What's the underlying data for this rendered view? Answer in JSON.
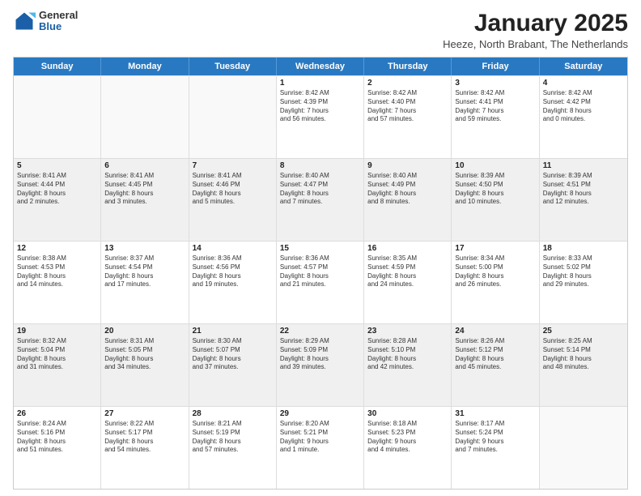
{
  "logo": {
    "general": "General",
    "blue": "Blue"
  },
  "header": {
    "title": "January 2025",
    "subtitle": "Heeze, North Brabant, The Netherlands"
  },
  "calendar": {
    "days": [
      "Sunday",
      "Monday",
      "Tuesday",
      "Wednesday",
      "Thursday",
      "Friday",
      "Saturday"
    ],
    "weeks": [
      [
        {
          "day": "",
          "content": ""
        },
        {
          "day": "",
          "content": ""
        },
        {
          "day": "",
          "content": ""
        },
        {
          "day": "1",
          "content": "Sunrise: 8:42 AM\nSunset: 4:39 PM\nDaylight: 7 hours\nand 56 minutes."
        },
        {
          "day": "2",
          "content": "Sunrise: 8:42 AM\nSunset: 4:40 PM\nDaylight: 7 hours\nand 57 minutes."
        },
        {
          "day": "3",
          "content": "Sunrise: 8:42 AM\nSunset: 4:41 PM\nDaylight: 7 hours\nand 59 minutes."
        },
        {
          "day": "4",
          "content": "Sunrise: 8:42 AM\nSunset: 4:42 PM\nDaylight: 8 hours\nand 0 minutes."
        }
      ],
      [
        {
          "day": "5",
          "content": "Sunrise: 8:41 AM\nSunset: 4:44 PM\nDaylight: 8 hours\nand 2 minutes."
        },
        {
          "day": "6",
          "content": "Sunrise: 8:41 AM\nSunset: 4:45 PM\nDaylight: 8 hours\nand 3 minutes."
        },
        {
          "day": "7",
          "content": "Sunrise: 8:41 AM\nSunset: 4:46 PM\nDaylight: 8 hours\nand 5 minutes."
        },
        {
          "day": "8",
          "content": "Sunrise: 8:40 AM\nSunset: 4:47 PM\nDaylight: 8 hours\nand 7 minutes."
        },
        {
          "day": "9",
          "content": "Sunrise: 8:40 AM\nSunset: 4:49 PM\nDaylight: 8 hours\nand 8 minutes."
        },
        {
          "day": "10",
          "content": "Sunrise: 8:39 AM\nSunset: 4:50 PM\nDaylight: 8 hours\nand 10 minutes."
        },
        {
          "day": "11",
          "content": "Sunrise: 8:39 AM\nSunset: 4:51 PM\nDaylight: 8 hours\nand 12 minutes."
        }
      ],
      [
        {
          "day": "12",
          "content": "Sunrise: 8:38 AM\nSunset: 4:53 PM\nDaylight: 8 hours\nand 14 minutes."
        },
        {
          "day": "13",
          "content": "Sunrise: 8:37 AM\nSunset: 4:54 PM\nDaylight: 8 hours\nand 17 minutes."
        },
        {
          "day": "14",
          "content": "Sunrise: 8:36 AM\nSunset: 4:56 PM\nDaylight: 8 hours\nand 19 minutes."
        },
        {
          "day": "15",
          "content": "Sunrise: 8:36 AM\nSunset: 4:57 PM\nDaylight: 8 hours\nand 21 minutes."
        },
        {
          "day": "16",
          "content": "Sunrise: 8:35 AM\nSunset: 4:59 PM\nDaylight: 8 hours\nand 24 minutes."
        },
        {
          "day": "17",
          "content": "Sunrise: 8:34 AM\nSunset: 5:00 PM\nDaylight: 8 hours\nand 26 minutes."
        },
        {
          "day": "18",
          "content": "Sunrise: 8:33 AM\nSunset: 5:02 PM\nDaylight: 8 hours\nand 29 minutes."
        }
      ],
      [
        {
          "day": "19",
          "content": "Sunrise: 8:32 AM\nSunset: 5:04 PM\nDaylight: 8 hours\nand 31 minutes."
        },
        {
          "day": "20",
          "content": "Sunrise: 8:31 AM\nSunset: 5:05 PM\nDaylight: 8 hours\nand 34 minutes."
        },
        {
          "day": "21",
          "content": "Sunrise: 8:30 AM\nSunset: 5:07 PM\nDaylight: 8 hours\nand 37 minutes."
        },
        {
          "day": "22",
          "content": "Sunrise: 8:29 AM\nSunset: 5:09 PM\nDaylight: 8 hours\nand 39 minutes."
        },
        {
          "day": "23",
          "content": "Sunrise: 8:28 AM\nSunset: 5:10 PM\nDaylight: 8 hours\nand 42 minutes."
        },
        {
          "day": "24",
          "content": "Sunrise: 8:26 AM\nSunset: 5:12 PM\nDaylight: 8 hours\nand 45 minutes."
        },
        {
          "day": "25",
          "content": "Sunrise: 8:25 AM\nSunset: 5:14 PM\nDaylight: 8 hours\nand 48 minutes."
        }
      ],
      [
        {
          "day": "26",
          "content": "Sunrise: 8:24 AM\nSunset: 5:16 PM\nDaylight: 8 hours\nand 51 minutes."
        },
        {
          "day": "27",
          "content": "Sunrise: 8:22 AM\nSunset: 5:17 PM\nDaylight: 8 hours\nand 54 minutes."
        },
        {
          "day": "28",
          "content": "Sunrise: 8:21 AM\nSunset: 5:19 PM\nDaylight: 8 hours\nand 57 minutes."
        },
        {
          "day": "29",
          "content": "Sunrise: 8:20 AM\nSunset: 5:21 PM\nDaylight: 9 hours\nand 1 minute."
        },
        {
          "day": "30",
          "content": "Sunrise: 8:18 AM\nSunset: 5:23 PM\nDaylight: 9 hours\nand 4 minutes."
        },
        {
          "day": "31",
          "content": "Sunrise: 8:17 AM\nSunset: 5:24 PM\nDaylight: 9 hours\nand 7 minutes."
        },
        {
          "day": "",
          "content": ""
        }
      ]
    ]
  }
}
